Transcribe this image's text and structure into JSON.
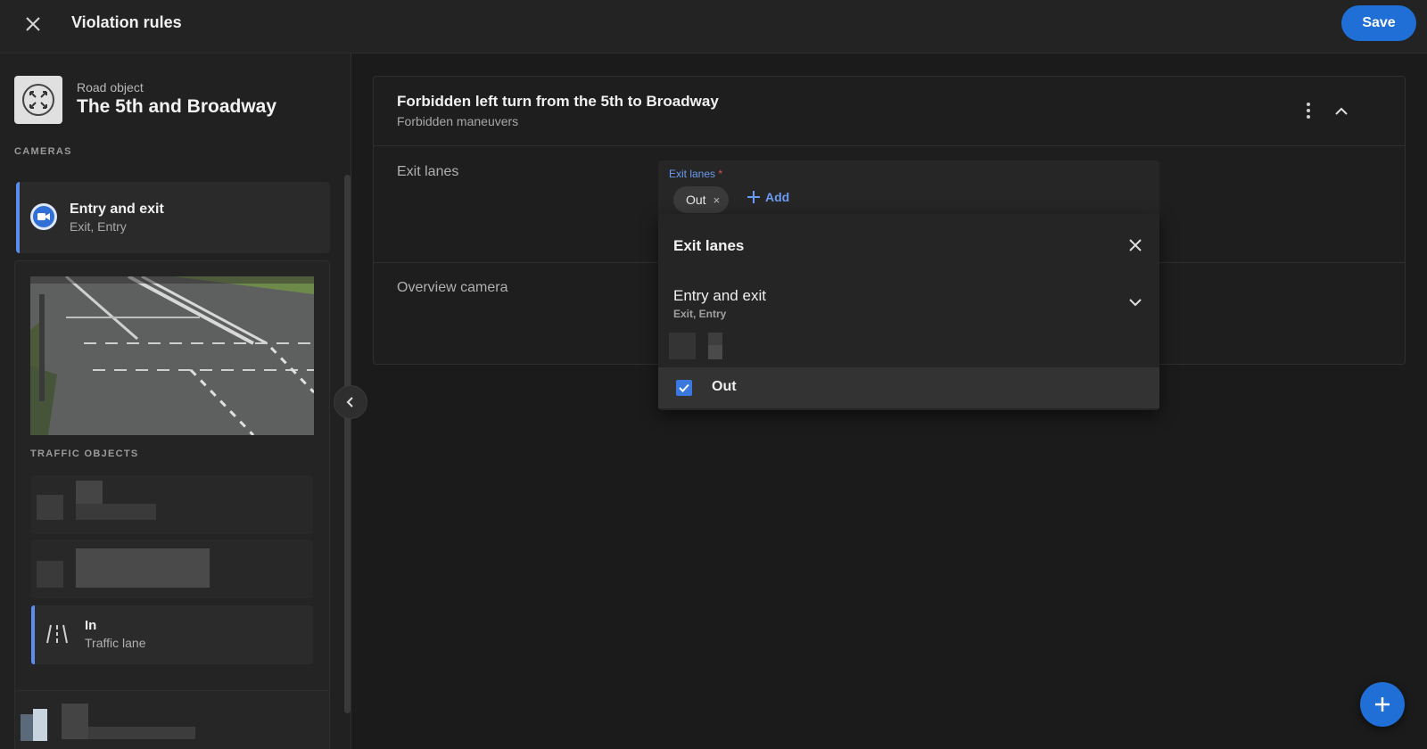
{
  "header": {
    "title": "Violation rules",
    "save_label": "Save"
  },
  "sidebar": {
    "object_caption": "Road object",
    "object_title": "The 5th and Broadway",
    "cameras_label": "CAMERAS",
    "camera": {
      "title": "Entry and exit",
      "subtitle": "Exit, Entry"
    },
    "traffic_objects_label": "TRAFFIC OBJECTS",
    "lane": {
      "title": "In",
      "subtitle": "Traffic lane"
    }
  },
  "rule": {
    "title": "Forbidden left turn from the 5th to Broadway",
    "subtitle": "Forbidden maneuvers",
    "fields": {
      "exit_lanes_label": "Exit lanes",
      "overview_camera_label": "Overview camera"
    }
  },
  "exit_lanes_field": {
    "label": "Exit lanes",
    "required_mark": "*",
    "chip_label": "Out",
    "chip_remove": "×",
    "add_label": "Add"
  },
  "popover": {
    "title": "Exit lanes",
    "group_title": "Entry and exit",
    "group_subtitle": "Exit, Entry",
    "option_label": "Out",
    "option_checked": true
  },
  "colors": {
    "accent": "#1f6fd6",
    "link": "#6b9bf0",
    "background": "#1b1b1b"
  }
}
